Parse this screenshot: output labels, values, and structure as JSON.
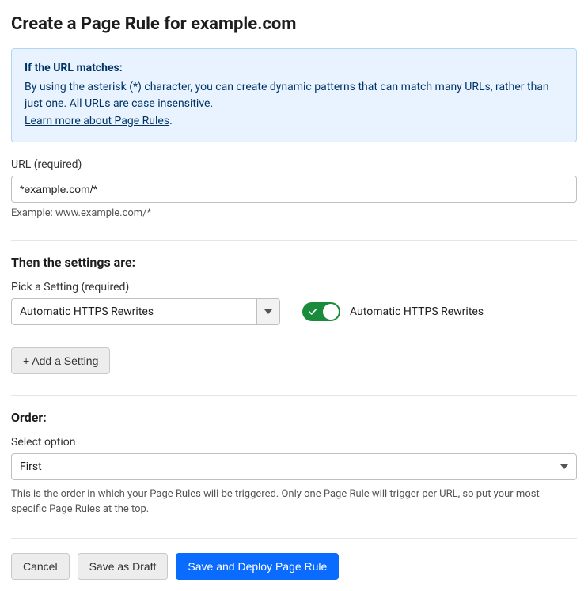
{
  "page_title": "Create a Page Rule for example.com",
  "info": {
    "heading": "If the URL matches:",
    "body": "By using the asterisk (*) character, you can create dynamic patterns that can match many URLs, rather than just one. All URLs are case insensitive.",
    "link_text": "Learn more about Page Rules",
    "link_suffix": "."
  },
  "url_field": {
    "label": "URL (required)",
    "value": "*example.com/*",
    "example": "Example: www.example.com/*"
  },
  "settings": {
    "heading": "Then the settings are:",
    "picker_label": "Pick a Setting (required)",
    "picker_value": "Automatic HTTPS Rewrites",
    "toggle_label": "Automatic HTTPS Rewrites",
    "toggle_on": true,
    "add_button": "+ Add a Setting"
  },
  "order": {
    "heading": "Order:",
    "select_label": "Select option",
    "select_value": "First",
    "description": "This is the order in which your Page Rules will be triggered. Only one Page Rule will trigger per URL, so put your most specific Page Rules at the top."
  },
  "actions": {
    "cancel": "Cancel",
    "save_draft": "Save as Draft",
    "save_deploy": "Save and Deploy Page Rule"
  }
}
